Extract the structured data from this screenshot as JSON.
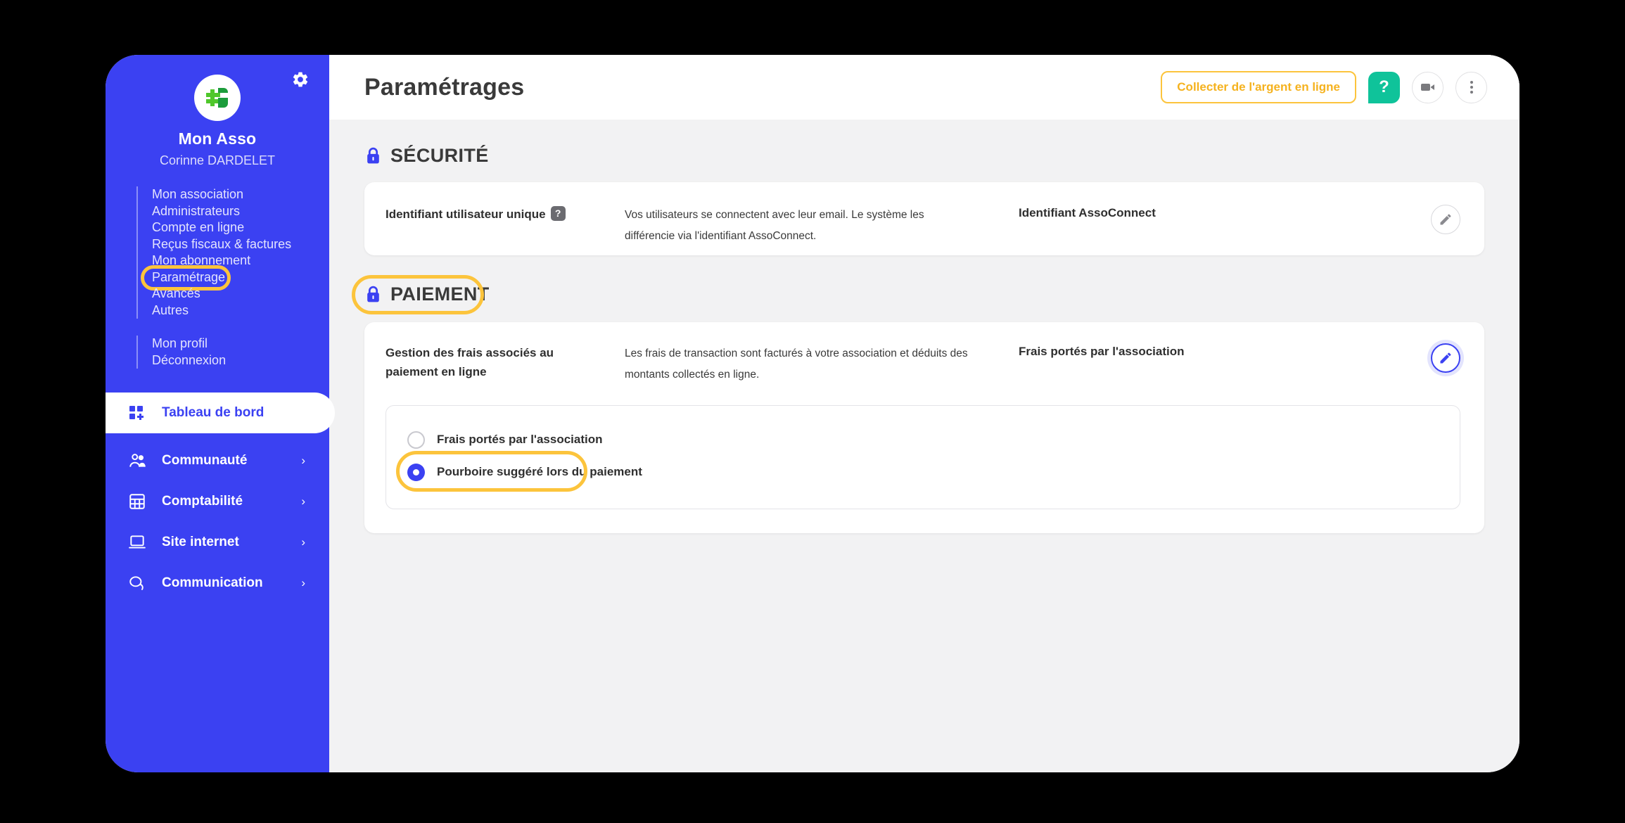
{
  "sidebar": {
    "gear_icon": "gear-icon",
    "logo_icon": "assoconnect-logo",
    "brand_name": "Mon Asso",
    "user_name": "Corinne DARDELET",
    "sub_items": [
      {
        "label": "Mon association",
        "highlighted": false
      },
      {
        "label": "Administrateurs",
        "highlighted": false
      },
      {
        "label": "Compte en ligne",
        "highlighted": false
      },
      {
        "label": "Reçus fiscaux & factures",
        "highlighted": false
      },
      {
        "label": "Mon abonnement",
        "highlighted": false
      },
      {
        "label": "Paramétrage",
        "highlighted": true
      },
      {
        "label": "Avancés",
        "highlighted": false
      },
      {
        "label": "Autres",
        "highlighted": false
      }
    ],
    "sub_items_secondary": [
      {
        "label": "Mon profil"
      },
      {
        "label": "Déconnexion"
      }
    ],
    "nav_items": [
      {
        "label": "Tableau de bord",
        "icon": "dashboard-icon",
        "active": true,
        "arrow": ""
      },
      {
        "label": "Communauté",
        "icon": "people-icon",
        "active": false,
        "arrow": "›"
      },
      {
        "label": "Comptabilité",
        "icon": "calculator-icon",
        "active": false,
        "arrow": "›"
      },
      {
        "label": "Site internet",
        "icon": "laptop-icon",
        "active": false,
        "arrow": "›"
      },
      {
        "label": "Communication",
        "icon": "chat-icon",
        "active": false,
        "arrow": "›"
      }
    ]
  },
  "header": {
    "title": "Paramétrages",
    "collect_button": "Collecter de l'argent en ligne",
    "help_button": "?",
    "video_icon": "video-camera-icon",
    "more_icon": "three-dots-icon"
  },
  "sections": {
    "security": {
      "title": "SÉCURITÉ",
      "lock_icon": "lock-icon",
      "row": {
        "label": "Identifiant utilisateur unique",
        "help_badge": "?",
        "description": "Vos utilisateurs se connectent avec leur email. Le système les différencie via l'identifiant AssoConnect.",
        "value": "Identifiant AssoConnect",
        "edit_icon": "pencil-icon"
      }
    },
    "payment": {
      "title": "PAIEMENT",
      "lock_icon": "lock-icon",
      "highlighted": true,
      "row": {
        "label": "Gestion des frais associés au paiement en ligne",
        "description": "Les frais de transaction sont facturés à votre association et déduits des montants collectés en ligne.",
        "value": "Frais portés par l'association",
        "edit_icon": "pencil-icon"
      },
      "options": [
        {
          "label": "Frais portés par l'association",
          "checked": false,
          "highlighted": false
        },
        {
          "label": "Pourboire suggéré lors du paiement",
          "checked": true,
          "highlighted": true
        }
      ]
    }
  },
  "colors": {
    "brand_blue": "#3B41F2",
    "annotation_yellow": "#FCC43C",
    "help_green": "#0FC39A",
    "page_bg": "#f2f2f3"
  }
}
